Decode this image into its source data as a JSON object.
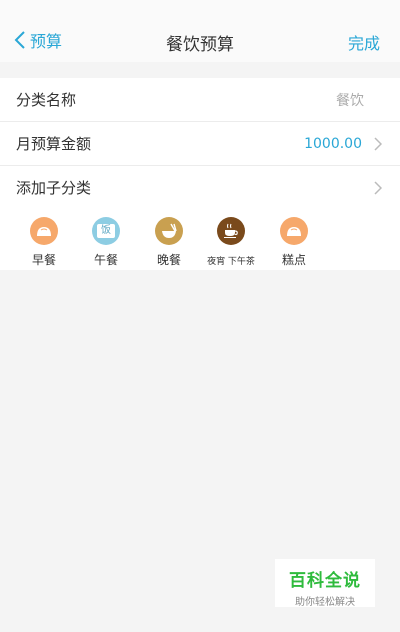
{
  "nav": {
    "back_label": "预算",
    "title": "餐饮预算",
    "done_label": "完成"
  },
  "form": {
    "category_name_label": "分类名称",
    "category_name_value": "餐饮",
    "monthly_budget_label": "月预算金额",
    "monthly_budget_value": "1000.00",
    "add_subcategory_label": "添加子分类"
  },
  "subcategories": [
    {
      "label": "早餐",
      "icon": "bun-icon",
      "color": "#f6a86b"
    },
    {
      "label": "午餐",
      "icon": "rice-bowl-icon",
      "color": "#8dcde3",
      "glyph": "饭"
    },
    {
      "label": "晚餐",
      "icon": "noodle-bowl-icon",
      "color": "#c9a050"
    },
    {
      "label": "夜宵 下午茶",
      "icon": "coffee-cup-icon",
      "color": "#7a4a1c"
    },
    {
      "label": "糕点",
      "icon": "bun-icon",
      "color": "#f6a86b"
    }
  ],
  "watermark": {
    "title": "百科全说",
    "subtitle": "助你轻松解决"
  },
  "colors": {
    "accent": "#2aa7d6",
    "background": "#f4f4f4"
  }
}
